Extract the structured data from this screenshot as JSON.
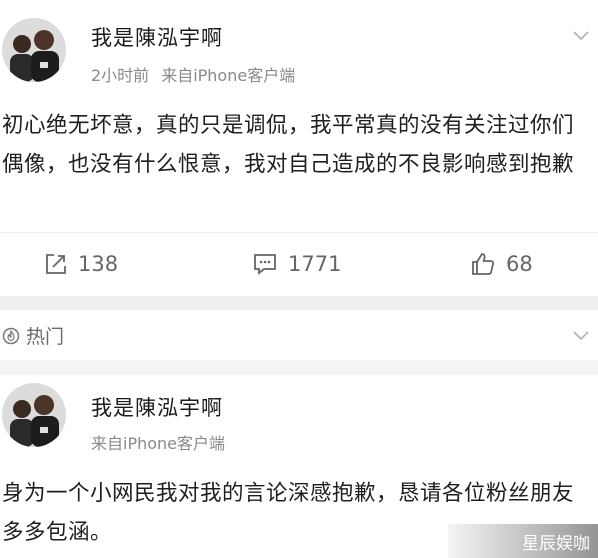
{
  "post1": {
    "username": "我是陳泓宇啊",
    "time": "2小时前",
    "source": "来自iPhone客户端",
    "text": "初心绝无坏意，真的只是调侃，我平常真的没有关注过你们偶像，也没有什么恨意，我对自己造成的不良影响感到抱歉"
  },
  "actions": {
    "repost_count": "138",
    "comment_count": "1771",
    "like_count": "68"
  },
  "hot": {
    "label": "热门"
  },
  "post2": {
    "username": "我是陳泓宇啊",
    "source": "来自iPhone客户端",
    "text": "身为一个小网民我对我的言论深感抱歉，恳请各位粉丝朋友多多包涵。"
  },
  "watermark": "星辰娱咖",
  "icons": [
    "chevron-down-icon",
    "repost-icon",
    "comment-icon",
    "like-icon",
    "fire-icon"
  ],
  "colors": {
    "text": "#1e1e1e",
    "meta": "#8a8a8a",
    "divider": "#eeeeee"
  }
}
